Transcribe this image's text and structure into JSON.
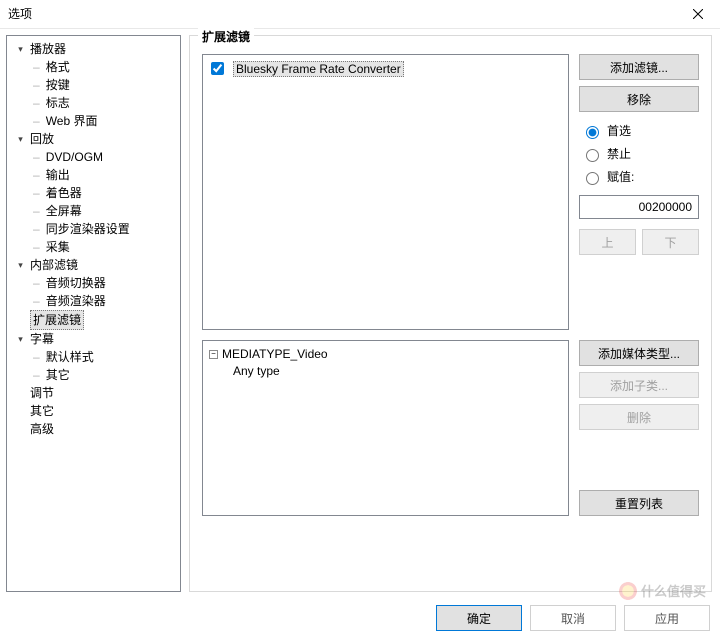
{
  "window": {
    "title": "选项"
  },
  "tree": {
    "n0": {
      "label": "播放器"
    },
    "n0c": [
      {
        "label": "格式"
      },
      {
        "label": "按键"
      },
      {
        "label": "标志"
      },
      {
        "label": "Web 界面"
      }
    ],
    "n1": {
      "label": "回放"
    },
    "n1c": [
      {
        "label": "DVD/OGM"
      },
      {
        "label": "输出"
      },
      {
        "label": "着色器"
      },
      {
        "label": "全屏幕"
      },
      {
        "label": "同步渲染器设置"
      },
      {
        "label": "采集"
      }
    ],
    "n2": {
      "label": "内部滤镜"
    },
    "n2c": [
      {
        "label": "音频切换器"
      },
      {
        "label": "音频渲染器"
      }
    ],
    "n3": {
      "label": "扩展滤镜"
    },
    "n4": {
      "label": "字幕"
    },
    "n4c": [
      {
        "label": "默认样式"
      },
      {
        "label": "其它"
      }
    ],
    "n5": {
      "label": "调节"
    },
    "n6": {
      "label": "其它"
    },
    "n7": {
      "label": "高级"
    }
  },
  "panel": {
    "title": "扩展滤镜",
    "filter_item": "Bluesky Frame Rate Converter",
    "btn_add_filter": "添加滤镜...",
    "btn_remove": "移除",
    "radio_preferred": "首选",
    "radio_blocked": "禁止",
    "radio_value": "赋值:",
    "value_text": "00200000",
    "btn_up": "上",
    "btn_down": "下",
    "media_root": "MEDIATYPE_Video",
    "media_child": "Any type",
    "btn_add_media": "添加媒体类型...",
    "btn_add_sub": "添加子类...",
    "btn_delete": "删除",
    "btn_reset": "重置列表"
  },
  "footer": {
    "ok": "确定",
    "cancel": "取消",
    "apply": "应用"
  },
  "watermark": "什么值得买"
}
